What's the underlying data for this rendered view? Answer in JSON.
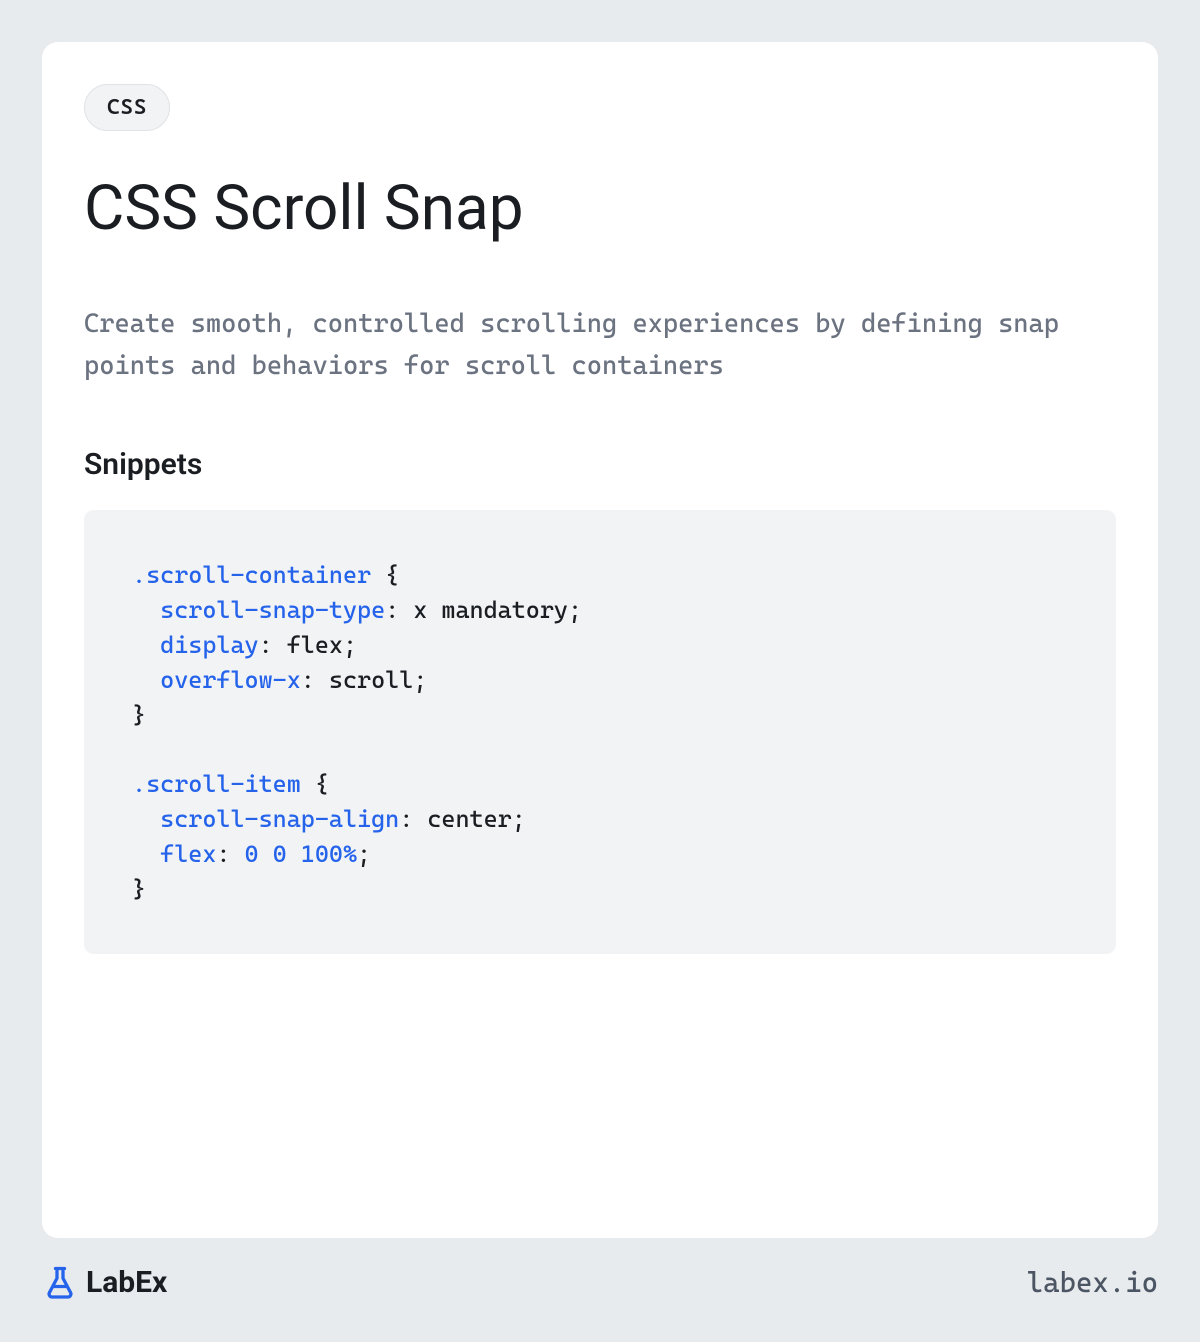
{
  "tag": "CSS",
  "title": "CSS Scroll Snap",
  "description": "Create smooth, controlled scrolling experiences by defining snap points and behaviors for scroll containers",
  "section_heading": "Snippets",
  "code": {
    "selector1": ".scroll-container",
    "prop1": "scroll-snap-type",
    "val1": ": x mandatory;",
    "prop2": "display",
    "val2": ": flex;",
    "prop3": "overflow-x",
    "val3": ": scroll;",
    "selector2": ".scroll-item",
    "prop4": "scroll-snap-align",
    "val4": ": center;",
    "prop5": "flex",
    "val5_pre": ": ",
    "val5_num": "0 0 100%",
    "val5_post": ";"
  },
  "logo_text": "LabEx",
  "url": "labex.io"
}
